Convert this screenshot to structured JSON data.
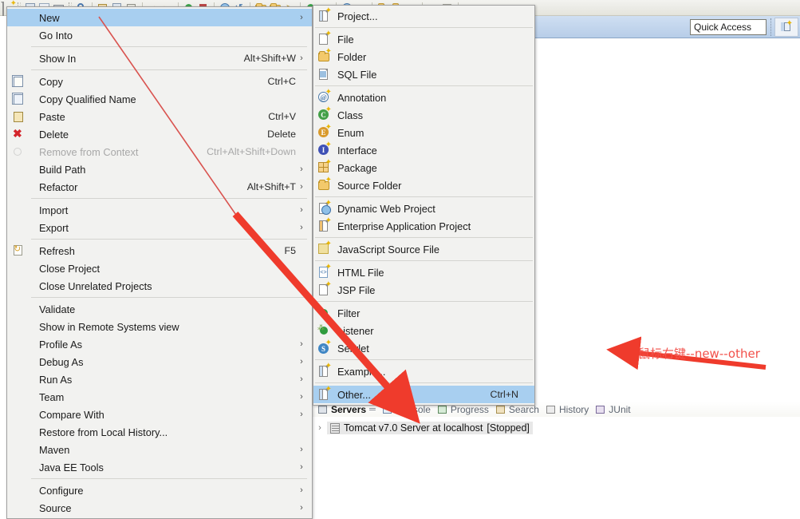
{
  "window": {
    "quick_access_placeholder": "Quick Access",
    "perspective_icon": "new-perspective-icon"
  },
  "context_menu": {
    "items": [
      {
        "label": "New",
        "accel": "",
        "arrow": true,
        "icon": "",
        "highlighted": true,
        "disabled": false
      },
      {
        "label": "Go Into",
        "accel": "",
        "arrow": false,
        "icon": "",
        "highlighted": false,
        "disabled": false
      },
      {
        "separator": true
      },
      {
        "label": "Show In",
        "accel": "Alt+Shift+W",
        "arrow": true,
        "icon": "",
        "highlighted": false,
        "disabled": false
      },
      {
        "separator": true
      },
      {
        "label": "Copy",
        "accel": "Ctrl+C",
        "arrow": false,
        "icon": "copy-icon",
        "highlighted": false,
        "disabled": false
      },
      {
        "label": "Copy Qualified Name",
        "accel": "",
        "arrow": false,
        "icon": "copy-qualified-icon",
        "highlighted": false,
        "disabled": false
      },
      {
        "label": "Paste",
        "accel": "Ctrl+V",
        "arrow": false,
        "icon": "paste-icon",
        "highlighted": false,
        "disabled": false
      },
      {
        "label": "Delete",
        "accel": "Delete",
        "arrow": false,
        "icon": "delete-icon",
        "highlighted": false,
        "disabled": false
      },
      {
        "label": "Remove from Context",
        "accel": "Ctrl+Alt+Shift+Down",
        "arrow": false,
        "icon": "remove-context-icon",
        "highlighted": false,
        "disabled": true
      },
      {
        "label": "Build Path",
        "accel": "",
        "arrow": true,
        "icon": "",
        "highlighted": false,
        "disabled": false
      },
      {
        "label": "Refactor",
        "accel": "Alt+Shift+T",
        "arrow": true,
        "icon": "",
        "highlighted": false,
        "disabled": false
      },
      {
        "separator": true
      },
      {
        "label": "Import",
        "accel": "",
        "arrow": true,
        "icon": "",
        "highlighted": false,
        "disabled": false
      },
      {
        "label": "Export",
        "accel": "",
        "arrow": true,
        "icon": "",
        "highlighted": false,
        "disabled": false
      },
      {
        "separator": true
      },
      {
        "label": "Refresh",
        "accel": "F5",
        "arrow": false,
        "icon": "refresh-icon",
        "highlighted": false,
        "disabled": false
      },
      {
        "label": "Close Project",
        "accel": "",
        "arrow": false,
        "icon": "",
        "highlighted": false,
        "disabled": false
      },
      {
        "label": "Close Unrelated Projects",
        "accel": "",
        "arrow": false,
        "icon": "",
        "highlighted": false,
        "disabled": false
      },
      {
        "separator": true
      },
      {
        "label": "Validate",
        "accel": "",
        "arrow": false,
        "icon": "",
        "highlighted": false,
        "disabled": false
      },
      {
        "label": "Show in Remote Systems view",
        "accel": "",
        "arrow": false,
        "icon": "",
        "highlighted": false,
        "disabled": false
      },
      {
        "label": "Profile As",
        "accel": "",
        "arrow": true,
        "icon": "",
        "highlighted": false,
        "disabled": false
      },
      {
        "label": "Debug As",
        "accel": "",
        "arrow": true,
        "icon": "",
        "highlighted": false,
        "disabled": false
      },
      {
        "label": "Run As",
        "accel": "",
        "arrow": true,
        "icon": "",
        "highlighted": false,
        "disabled": false
      },
      {
        "label": "Team",
        "accel": "",
        "arrow": true,
        "icon": "",
        "highlighted": false,
        "disabled": false
      },
      {
        "label": "Compare With",
        "accel": "",
        "arrow": true,
        "icon": "",
        "highlighted": false,
        "disabled": false
      },
      {
        "label": "Restore from Local History...",
        "accel": "",
        "arrow": false,
        "icon": "",
        "highlighted": false,
        "disabled": false
      },
      {
        "label": "Maven",
        "accel": "",
        "arrow": true,
        "icon": "",
        "highlighted": false,
        "disabled": false
      },
      {
        "label": "Java EE Tools",
        "accel": "",
        "arrow": true,
        "icon": "",
        "highlighted": false,
        "disabled": false
      },
      {
        "separator": true
      },
      {
        "label": "Configure",
        "accel": "",
        "arrow": true,
        "icon": "",
        "highlighted": false,
        "disabled": false
      },
      {
        "label": "Source",
        "accel": "",
        "arrow": true,
        "icon": "",
        "highlighted": false,
        "disabled": false
      }
    ]
  },
  "new_submenu": {
    "items": [
      {
        "label": "Project...",
        "accel": "",
        "icon": "new-project-icon",
        "highlighted": false
      },
      {
        "separator": true
      },
      {
        "label": "File",
        "accel": "",
        "icon": "new-file-icon",
        "highlighted": false
      },
      {
        "label": "Folder",
        "accel": "",
        "icon": "new-folder-icon",
        "highlighted": false
      },
      {
        "label": "SQL File",
        "accel": "",
        "icon": "sql-file-icon",
        "highlighted": false
      },
      {
        "separator": true
      },
      {
        "label": "Annotation",
        "accel": "",
        "icon": "annotation-icon",
        "highlighted": false
      },
      {
        "label": "Class",
        "accel": "",
        "icon": "class-icon",
        "highlighted": false
      },
      {
        "label": "Enum",
        "accel": "",
        "icon": "enum-icon",
        "highlighted": false
      },
      {
        "label": "Interface",
        "accel": "",
        "icon": "interface-icon",
        "highlighted": false
      },
      {
        "label": "Package",
        "accel": "",
        "icon": "package-icon",
        "highlighted": false
      },
      {
        "label": "Source Folder",
        "accel": "",
        "icon": "source-folder-icon",
        "highlighted": false
      },
      {
        "separator": true
      },
      {
        "label": "Dynamic Web Project",
        "accel": "",
        "icon": "dynamic-web-project-icon",
        "highlighted": false
      },
      {
        "label": "Enterprise Application Project",
        "accel": "",
        "icon": "enterprise-app-project-icon",
        "highlighted": false
      },
      {
        "separator": true
      },
      {
        "label": "JavaScript Source File",
        "accel": "",
        "icon": "javascript-source-file-icon",
        "highlighted": false
      },
      {
        "separator": true
      },
      {
        "label": "HTML File",
        "accel": "",
        "icon": "html-file-icon",
        "highlighted": false
      },
      {
        "label": "JSP File",
        "accel": "",
        "icon": "jsp-file-icon",
        "highlighted": false
      },
      {
        "separator": true
      },
      {
        "label": "Filter",
        "accel": "",
        "icon": "filter-icon",
        "highlighted": false
      },
      {
        "label": "Listener",
        "accel": "",
        "icon": "listener-icon",
        "highlighted": false
      },
      {
        "label": "Servlet",
        "accel": "",
        "icon": "servlet-icon",
        "highlighted": false
      },
      {
        "separator": true
      },
      {
        "label": "Example...",
        "accel": "",
        "icon": "example-icon",
        "highlighted": false
      },
      {
        "separator": true
      },
      {
        "label": "Other...",
        "accel": "Ctrl+N",
        "icon": "other-icon",
        "highlighted": true
      }
    ]
  },
  "servers_view": {
    "tabs": [
      {
        "label": "Servers",
        "icon": "servers-icon",
        "active": true,
        "pin": true
      },
      {
        "label": "Console",
        "icon": "console-icon",
        "active": false,
        "pin": false
      },
      {
        "label": "Progress",
        "icon": "progress-icon",
        "active": false,
        "pin": false
      },
      {
        "label": "Search",
        "icon": "search-icon",
        "active": false,
        "pin": false
      },
      {
        "label": "History",
        "icon": "history-icon",
        "active": false,
        "pin": false
      },
      {
        "label": "JUnit",
        "icon": "junit-icon",
        "active": false,
        "pin": false
      }
    ],
    "rows": [
      {
        "name": "Tomcat v7.0 Server at localhost",
        "status": "[Stopped]",
        "expander": "›"
      }
    ]
  },
  "annotations": {
    "note_text": "鼠标右键--new--other",
    "arrow_color": "#ef3b2c",
    "thin_arrow_color": "#d9534f"
  },
  "colors": {
    "menu_bg": "#f2f2f0",
    "menu_highlight": "#a8cff0",
    "coolbar": "#c2d6ed",
    "annotation_red": "#f2504a"
  }
}
